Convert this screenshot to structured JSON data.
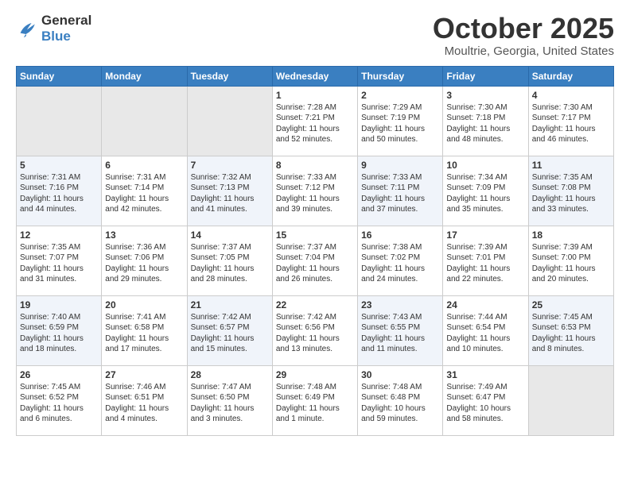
{
  "logo": {
    "line1": "General",
    "line2": "Blue"
  },
  "title": "October 2025",
  "subtitle": "Moultrie, Georgia, United States",
  "headers": [
    "Sunday",
    "Monday",
    "Tuesday",
    "Wednesday",
    "Thursday",
    "Friday",
    "Saturday"
  ],
  "rows": [
    [
      {
        "day": "",
        "content": ""
      },
      {
        "day": "",
        "content": ""
      },
      {
        "day": "",
        "content": ""
      },
      {
        "day": "1",
        "content": "Sunrise: 7:28 AM\nSunset: 7:21 PM\nDaylight: 11 hours\nand 52 minutes."
      },
      {
        "day": "2",
        "content": "Sunrise: 7:29 AM\nSunset: 7:19 PM\nDaylight: 11 hours\nand 50 minutes."
      },
      {
        "day": "3",
        "content": "Sunrise: 7:30 AM\nSunset: 7:18 PM\nDaylight: 11 hours\nand 48 minutes."
      },
      {
        "day": "4",
        "content": "Sunrise: 7:30 AM\nSunset: 7:17 PM\nDaylight: 11 hours\nand 46 minutes."
      }
    ],
    [
      {
        "day": "5",
        "content": "Sunrise: 7:31 AM\nSunset: 7:16 PM\nDaylight: 11 hours\nand 44 minutes."
      },
      {
        "day": "6",
        "content": "Sunrise: 7:31 AM\nSunset: 7:14 PM\nDaylight: 11 hours\nand 42 minutes."
      },
      {
        "day": "7",
        "content": "Sunrise: 7:32 AM\nSunset: 7:13 PM\nDaylight: 11 hours\nand 41 minutes."
      },
      {
        "day": "8",
        "content": "Sunrise: 7:33 AM\nSunset: 7:12 PM\nDaylight: 11 hours\nand 39 minutes."
      },
      {
        "day": "9",
        "content": "Sunrise: 7:33 AM\nSunset: 7:11 PM\nDaylight: 11 hours\nand 37 minutes."
      },
      {
        "day": "10",
        "content": "Sunrise: 7:34 AM\nSunset: 7:09 PM\nDaylight: 11 hours\nand 35 minutes."
      },
      {
        "day": "11",
        "content": "Sunrise: 7:35 AM\nSunset: 7:08 PM\nDaylight: 11 hours\nand 33 minutes."
      }
    ],
    [
      {
        "day": "12",
        "content": "Sunrise: 7:35 AM\nSunset: 7:07 PM\nDaylight: 11 hours\nand 31 minutes."
      },
      {
        "day": "13",
        "content": "Sunrise: 7:36 AM\nSunset: 7:06 PM\nDaylight: 11 hours\nand 29 minutes."
      },
      {
        "day": "14",
        "content": "Sunrise: 7:37 AM\nSunset: 7:05 PM\nDaylight: 11 hours\nand 28 minutes."
      },
      {
        "day": "15",
        "content": "Sunrise: 7:37 AM\nSunset: 7:04 PM\nDaylight: 11 hours\nand 26 minutes."
      },
      {
        "day": "16",
        "content": "Sunrise: 7:38 AM\nSunset: 7:02 PM\nDaylight: 11 hours\nand 24 minutes."
      },
      {
        "day": "17",
        "content": "Sunrise: 7:39 AM\nSunset: 7:01 PM\nDaylight: 11 hours\nand 22 minutes."
      },
      {
        "day": "18",
        "content": "Sunrise: 7:39 AM\nSunset: 7:00 PM\nDaylight: 11 hours\nand 20 minutes."
      }
    ],
    [
      {
        "day": "19",
        "content": "Sunrise: 7:40 AM\nSunset: 6:59 PM\nDaylight: 11 hours\nand 18 minutes."
      },
      {
        "day": "20",
        "content": "Sunrise: 7:41 AM\nSunset: 6:58 PM\nDaylight: 11 hours\nand 17 minutes."
      },
      {
        "day": "21",
        "content": "Sunrise: 7:42 AM\nSunset: 6:57 PM\nDaylight: 11 hours\nand 15 minutes."
      },
      {
        "day": "22",
        "content": "Sunrise: 7:42 AM\nSunset: 6:56 PM\nDaylight: 11 hours\nand 13 minutes."
      },
      {
        "day": "23",
        "content": "Sunrise: 7:43 AM\nSunset: 6:55 PM\nDaylight: 11 hours\nand 11 minutes."
      },
      {
        "day": "24",
        "content": "Sunrise: 7:44 AM\nSunset: 6:54 PM\nDaylight: 11 hours\nand 10 minutes."
      },
      {
        "day": "25",
        "content": "Sunrise: 7:45 AM\nSunset: 6:53 PM\nDaylight: 11 hours\nand 8 minutes."
      }
    ],
    [
      {
        "day": "26",
        "content": "Sunrise: 7:45 AM\nSunset: 6:52 PM\nDaylight: 11 hours\nand 6 minutes."
      },
      {
        "day": "27",
        "content": "Sunrise: 7:46 AM\nSunset: 6:51 PM\nDaylight: 11 hours\nand 4 minutes."
      },
      {
        "day": "28",
        "content": "Sunrise: 7:47 AM\nSunset: 6:50 PM\nDaylight: 11 hours\nand 3 minutes."
      },
      {
        "day": "29",
        "content": "Sunrise: 7:48 AM\nSunset: 6:49 PM\nDaylight: 11 hours\nand 1 minute."
      },
      {
        "day": "30",
        "content": "Sunrise: 7:48 AM\nSunset: 6:48 PM\nDaylight: 10 hours\nand 59 minutes."
      },
      {
        "day": "31",
        "content": "Sunrise: 7:49 AM\nSunset: 6:47 PM\nDaylight: 10 hours\nand 58 minutes."
      },
      {
        "day": "",
        "content": ""
      }
    ]
  ]
}
